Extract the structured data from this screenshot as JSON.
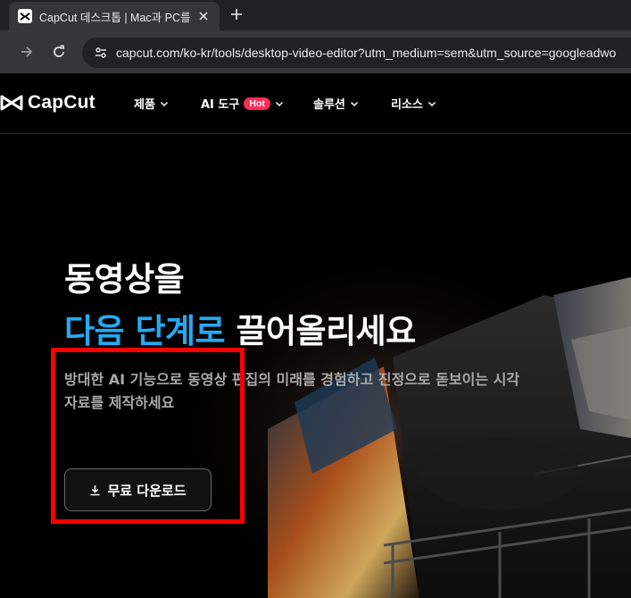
{
  "browser": {
    "tab_title": "CapCut 데스크톱 | Mac과 PC를",
    "url": "capcut.com/ko-kr/tools/desktop-video-editor?utm_medium=sem&utm_source=googleadwo"
  },
  "site": {
    "logo_text": "CapCut",
    "nav": [
      {
        "label": "제품"
      },
      {
        "label": "AI 도구",
        "badge": "Hot"
      },
      {
        "label": "솔루션"
      },
      {
        "label": "리소스"
      }
    ]
  },
  "hero": {
    "headline_line1": "동영상을",
    "headline_highlight": "다음 단계로",
    "headline_rest": " 끌어올리세요",
    "subtitle": "방대한 AI 기능으로 동영상 편집의 미래를 경험하고 진정으로 돋보이는 시각 자료를 제작하세요",
    "download_label": "무료 다운로드"
  },
  "colors": {
    "accent_gradient_start": "#1fb8f0",
    "hot_badge": "#fe2c55",
    "highlight_box": "#ff0000"
  }
}
